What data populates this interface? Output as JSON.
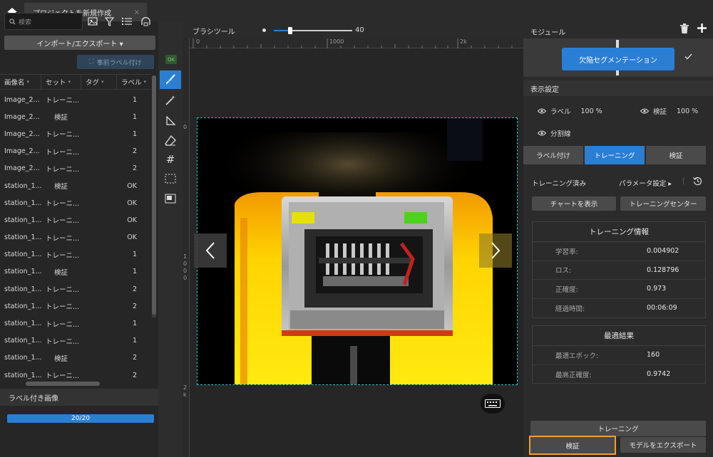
{
  "titlebar": {
    "tab_title": "プロジェクトを新規作成",
    "tab_close": "×"
  },
  "left": {
    "search_placeholder": "検索",
    "import_export": "インポート/エクスポート ▾",
    "pre_label": "事前ラベル付け",
    "columns": [
      "画像名",
      "セット",
      "タグ",
      "ラベル"
    ],
    "rows": [
      {
        "name": "Image_2...",
        "set": "トレーニ...",
        "tag": "",
        "label": "1"
      },
      {
        "name": "Image_2...",
        "set": "検証",
        "tag": "",
        "label": "1"
      },
      {
        "name": "Image_2...",
        "set": "トレーニ...",
        "tag": "",
        "label": "1"
      },
      {
        "name": "Image_2...",
        "set": "トレーニ...",
        "tag": "",
        "label": "2"
      },
      {
        "name": "Image_2...",
        "set": "トレーニ...",
        "tag": "",
        "label": "2"
      },
      {
        "name": "station_1...",
        "set": "検証",
        "tag": "",
        "label": "OK"
      },
      {
        "name": "station_1...",
        "set": "トレーニ...",
        "tag": "",
        "label": "OK"
      },
      {
        "name": "station_1...",
        "set": "トレーニ...",
        "tag": "",
        "label": "OK"
      },
      {
        "name": "station_1...",
        "set": "トレーニ...",
        "tag": "",
        "label": "OK"
      },
      {
        "name": "station_1...",
        "set": "トレーニ...",
        "tag": "",
        "label": "1"
      },
      {
        "name": "station_1...",
        "set": "検証",
        "tag": "",
        "label": "1"
      },
      {
        "name": "station_1...",
        "set": "トレーニ...",
        "tag": "",
        "label": "2"
      },
      {
        "name": "station_1...",
        "set": "トレーニ...",
        "tag": "",
        "label": "2"
      },
      {
        "name": "station_1...",
        "set": "トレーニ...",
        "tag": "",
        "label": "1"
      },
      {
        "name": "station_1...",
        "set": "トレーニ...",
        "tag": "",
        "label": "1"
      },
      {
        "name": "station_1...",
        "set": "検証",
        "tag": "",
        "label": "2"
      },
      {
        "name": "station_1...",
        "set": "トレーニ...",
        "tag": "",
        "label": "2"
      }
    ],
    "labeled_section": "ラベル付き画像",
    "progress_text": "20/20",
    "progress_fraction": 1.0
  },
  "tools": {
    "ok_badge": "OK"
  },
  "canvas": {
    "brush_label": "ブラシツール",
    "brush_value": "40",
    "ruler_top": [
      "0",
      "1000",
      "2k"
    ],
    "ruler_left": [
      "0",
      "1",
      "0",
      "0",
      "0",
      "2",
      "k"
    ]
  },
  "right": {
    "module_label": "モジュール",
    "module_name": "欠陥セグメンテーション",
    "display_settings": "表示設定",
    "disp_label": "ラベル",
    "disp_label_pct": "100 %",
    "disp_verify": "検証",
    "disp_verify_pct": "100 %",
    "disp_divider": "分割線",
    "tabs": [
      "ラベル付け",
      "トレーニング",
      "検証"
    ],
    "trained": "トレーニング済み",
    "param_settings": "パラメータ設定 ▸",
    "sep": "|",
    "show_chart": "チャートを表示",
    "training_center": "トレーニングセンター",
    "info_title": "トレーニング情報",
    "info": [
      {
        "k": "学習率:",
        "v": "0.004902"
      },
      {
        "k": "ロス:",
        "v": "0.128796"
      },
      {
        "k": "正確度:",
        "v": "0.973"
      },
      {
        "k": "経過時間:",
        "v": "00:06:09"
      }
    ],
    "best_title": "最適結果",
    "best": [
      {
        "k": "最適エポック:",
        "v": "160"
      },
      {
        "k": "最高正確度:",
        "v": "0.9742"
      }
    ],
    "train_btn": "トレーニング",
    "verify_btn": "検証",
    "export_btn": "モデルをエクスポート"
  },
  "colors": {
    "accent": "#2a7fd4",
    "highlight": "#f0a030"
  }
}
